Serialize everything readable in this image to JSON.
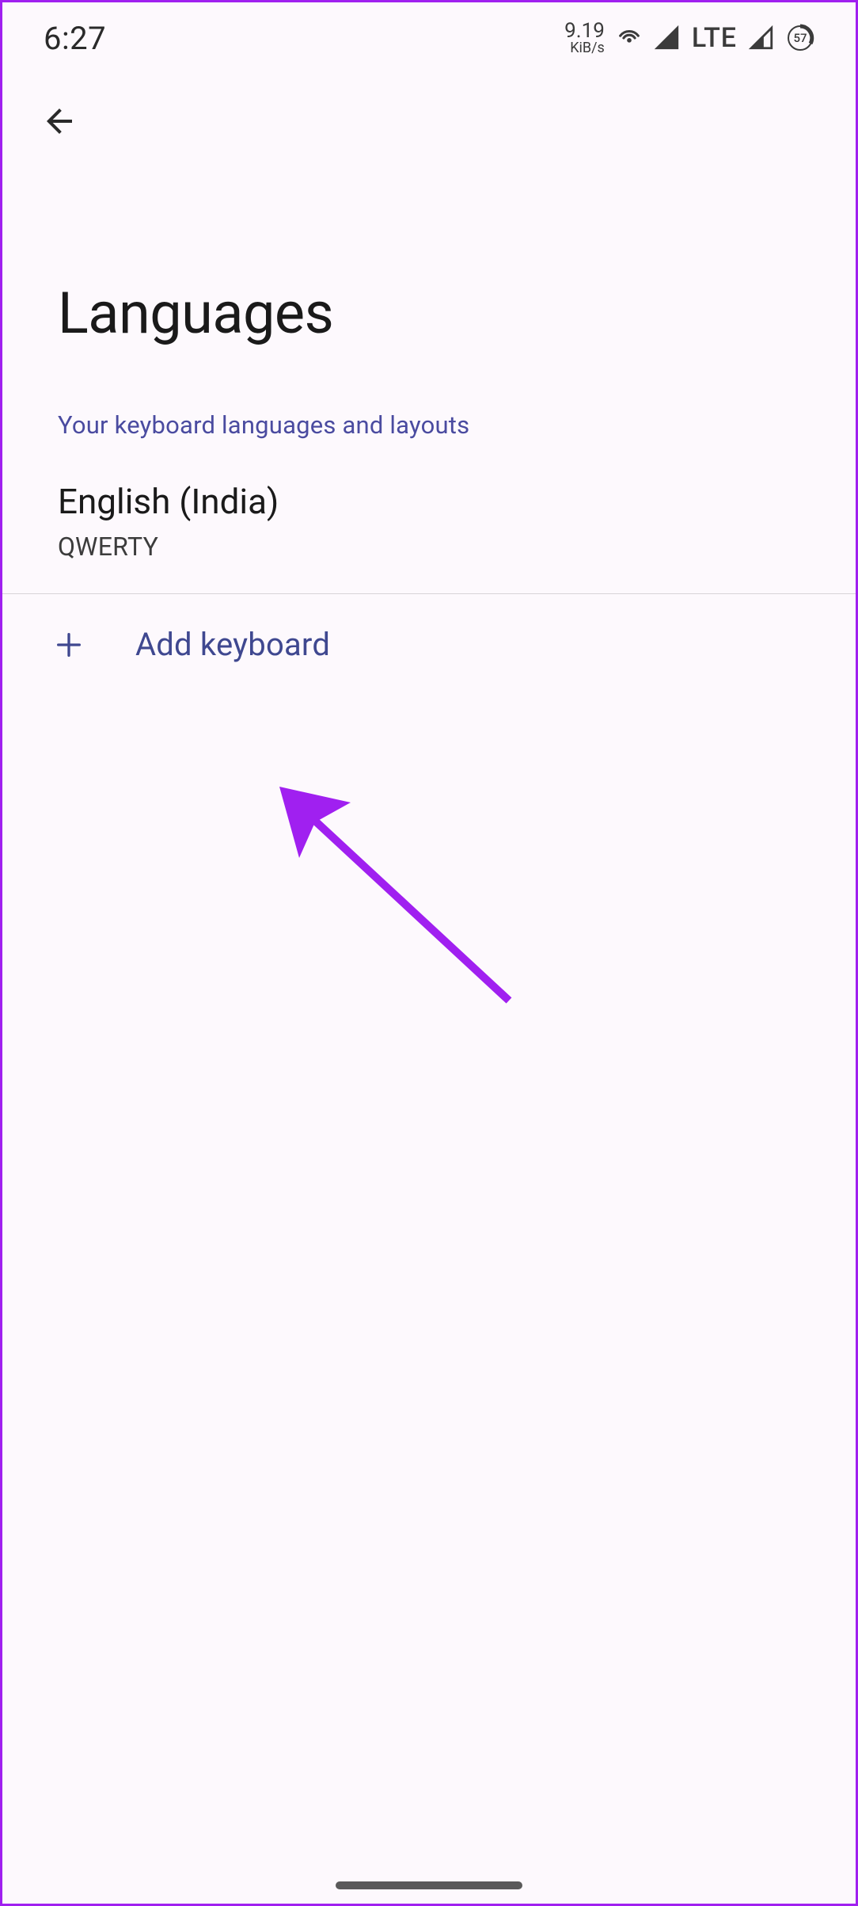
{
  "status": {
    "time": "6:27",
    "data_speed_value": "9.19",
    "data_speed_unit": "KiB/s",
    "lte_label": "LTE",
    "battery_level": "57"
  },
  "page": {
    "title": "Languages",
    "subtitle": "Your keyboard languages and layouts"
  },
  "languages": [
    {
      "name": "English (India)",
      "layout": "QWERTY"
    }
  ],
  "actions": {
    "add_keyboard_label": "Add keyboard"
  },
  "colors": {
    "accent": "#4a4ba0",
    "annotation": "#a020f0"
  }
}
